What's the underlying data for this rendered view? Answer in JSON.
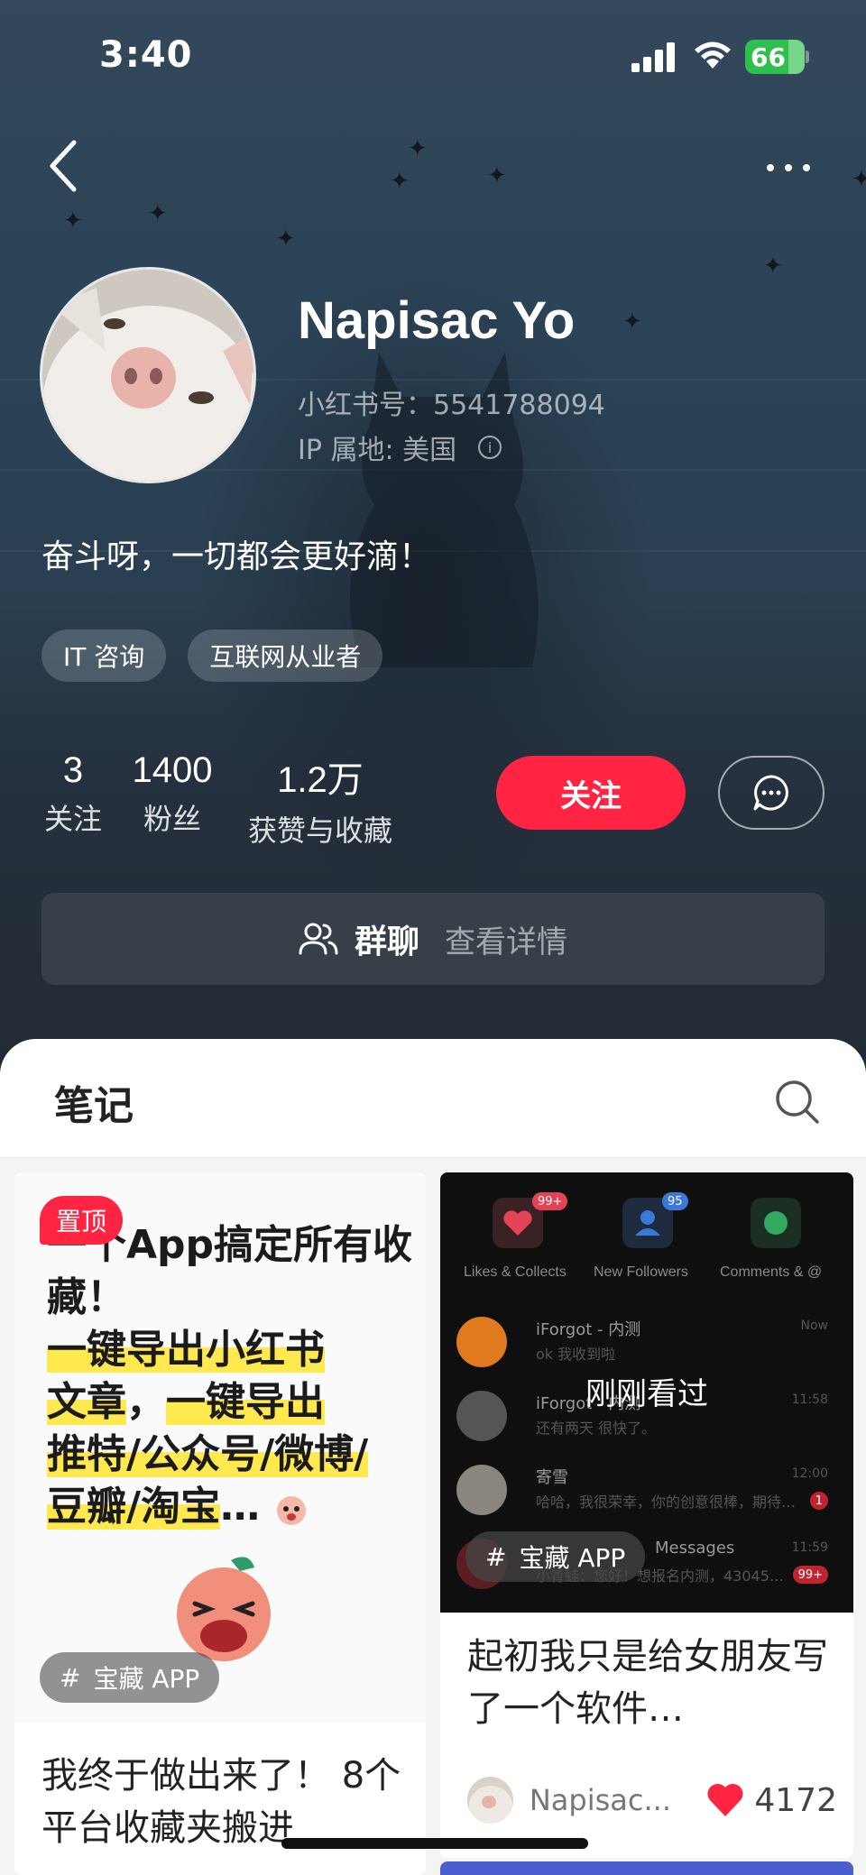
{
  "status_bar": {
    "time": "3:40",
    "battery": "66"
  },
  "profile": {
    "name": "Napisac Yo",
    "red_id": "小红书号：5541788094",
    "ip_location": "IP 属地: 美国",
    "bio": "奋斗呀，一切都会更好滴！",
    "tags": [
      "IT 咨询",
      "互联网从业者"
    ]
  },
  "stats": [
    {
      "value": "3",
      "label": "关注"
    },
    {
      "value": "1400",
      "label": "粉丝"
    },
    {
      "value": "1.2万",
      "label": "获赞与收藏"
    }
  ],
  "actions": {
    "follow_label": "关注"
  },
  "group_chat": {
    "title": "群聊",
    "detail": "查看详情"
  },
  "notes_section": {
    "title": "笔记",
    "left_card": {
      "pinned_label": "置顶",
      "cover_line1": "一个App搞定所有收藏！",
      "cover_hl1": "一键导出小红书",
      "cover_hl2": "文章",
      "cover_plain": "，",
      "cover_hl3": "一键导出",
      "cover_hl4": "推特/公众号/微博/",
      "cover_hl5": "豆瓣/淘宝",
      "cover_tail": "…",
      "topic": "宝藏 APP",
      "title": "我终于做出来了！ 8个平台收藏夹搬进"
    },
    "right_card": {
      "recently_viewed": "刚刚看过",
      "topic": "宝藏 APP",
      "title": "起初我只是给女朋友写了一个软件…",
      "author": "Napisac...",
      "likes": "4172",
      "screenshot": {
        "tabs": [
          {
            "label": "Likes & Collects",
            "badge": "99+",
            "color": "#e24455"
          },
          {
            "label": "New Followers",
            "badge": "95",
            "color": "#3b79d8"
          },
          {
            "label": "Comments & @",
            "badge": "",
            "color": "#31a95f"
          }
        ],
        "rows": [
          {
            "name": "iForgot - 内测",
            "msg": "ok 我收到啦",
            "time": "Now",
            "badge": ""
          },
          {
            "name": "iForgot - 内测",
            "msg": "还有两天 很快了。",
            "time": "11:58",
            "badge": ""
          },
          {
            "name": "寄雪",
            "msg": "哈哈，我很荣幸，你的创意很棒，期待…",
            "time": "12:00",
            "badge": "1"
          },
          {
            "name": "Messages",
            "msg": "小青蛙：您好！想报名内测，43045…",
            "time": "11:59",
            "badge": "99+"
          }
        ]
      }
    }
  }
}
